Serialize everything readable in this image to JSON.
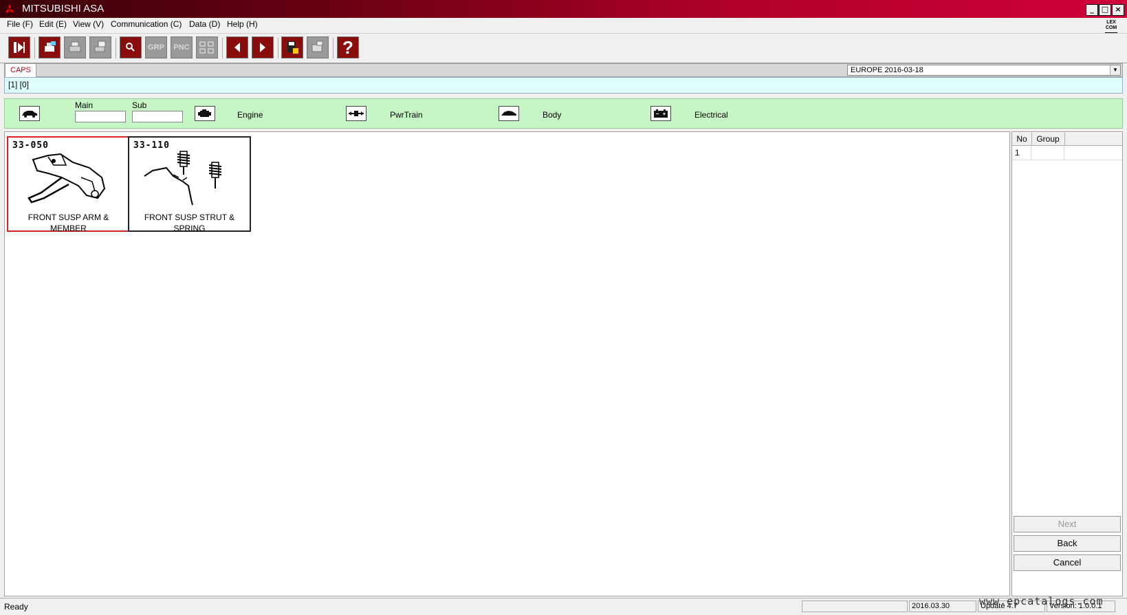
{
  "window": {
    "title": "MITSUBISHI ASA",
    "controls": [
      "_",
      "□",
      "×"
    ]
  },
  "menu": [
    "File (F)",
    "Edit (E)",
    "View (V)",
    "Communication (C)",
    "Data (D)",
    "Help (H)"
  ],
  "toolbar": {
    "grp_label": "GRP",
    "pnc_label": "PNC",
    "help_label": "?"
  },
  "tab": {
    "caps": "CAPS"
  },
  "region": {
    "value": "EUROPE   2016-03-18"
  },
  "path": "[1] [0]",
  "categories": {
    "main_label": "Main",
    "sub_label": "Sub",
    "engine": "Engine",
    "pwrtrain": "PwrTrain",
    "body": "Body",
    "electrical": "Electrical"
  },
  "cards": [
    {
      "code": "33-050",
      "name_line1": "FRONT SUSP ARM &",
      "name_line2": "MEMBER"
    },
    {
      "code": "33-110",
      "name_line1": "FRONT SUSP STRUT &",
      "name_line2": "SPRING"
    }
  ],
  "side_grid": {
    "headers": [
      "No",
      "Group"
    ],
    "rows": [
      {
        "no": "1",
        "group": ""
      }
    ]
  },
  "side_buttons": {
    "next": "Next",
    "back": "Back",
    "cancel": "Cancel"
  },
  "status": {
    "text": "Ready",
    "date": "2016.03.30",
    "update": "Update 4.7",
    "version": "Version: 1.0.0.1",
    "watermark": "www.epcatalogs.com"
  },
  "colors": {
    "title_gradient_end": "#d0003a",
    "category_bar": "#c6f5c6",
    "path_bar": "#dfffff",
    "selected_card_border": "#dd2222"
  }
}
